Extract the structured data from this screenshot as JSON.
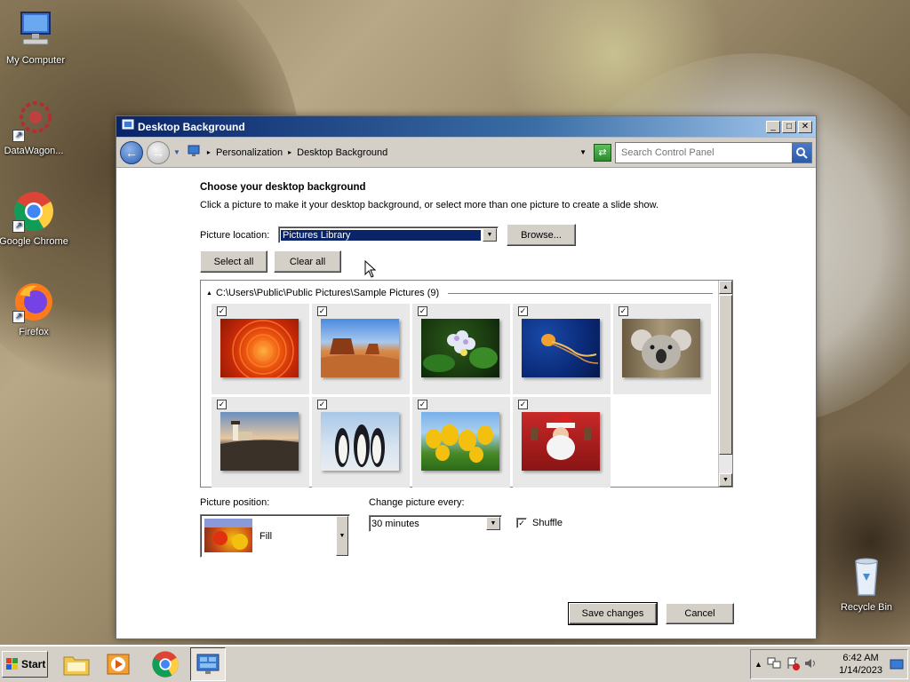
{
  "desktop": {
    "icons": [
      {
        "label": "My Computer"
      },
      {
        "label": "DataWagon..."
      },
      {
        "label": "Google Chrome"
      },
      {
        "label": "Firefox"
      },
      {
        "label": "Recycle Bin"
      }
    ]
  },
  "window": {
    "title": "Desktop Background",
    "breadcrumb": [
      "Personalization",
      "Desktop Background"
    ],
    "search_placeholder": "Search Control Panel",
    "heading": "Choose your desktop background",
    "subtext": "Click a picture to make it your desktop background, or select more than one picture to create a slide show.",
    "picture_location_label": "Picture location:",
    "picture_location_value": "Pictures Library",
    "browse_label": "Browse...",
    "select_all_label": "Select all",
    "clear_all_label": "Clear all",
    "gallery": {
      "group_path": "C:\\Users\\Public\\Public Pictures\\Sample Pictures (9)",
      "pictures": [
        {
          "name": "Chrysanthemum",
          "checked": true
        },
        {
          "name": "Desert",
          "checked": true
        },
        {
          "name": "Hydrangeas",
          "checked": true
        },
        {
          "name": "Jellyfish",
          "checked": true
        },
        {
          "name": "Koala",
          "checked": true
        },
        {
          "name": "Lighthouse",
          "checked": true
        },
        {
          "name": "Penguins",
          "checked": true
        },
        {
          "name": "Tulips",
          "checked": true
        },
        {
          "name": "Santa",
          "checked": true
        }
      ]
    },
    "picture_position_label": "Picture position:",
    "picture_position_value": "Fill",
    "change_picture_label": "Change picture every:",
    "change_picture_value": "30 minutes",
    "shuffle_label": "Shuffle",
    "shuffle_checked": true,
    "save_label": "Save changes",
    "cancel_label": "Cancel"
  },
  "taskbar": {
    "start_label": "Start",
    "time": "6:42 AM",
    "date": "1/14/2023"
  }
}
